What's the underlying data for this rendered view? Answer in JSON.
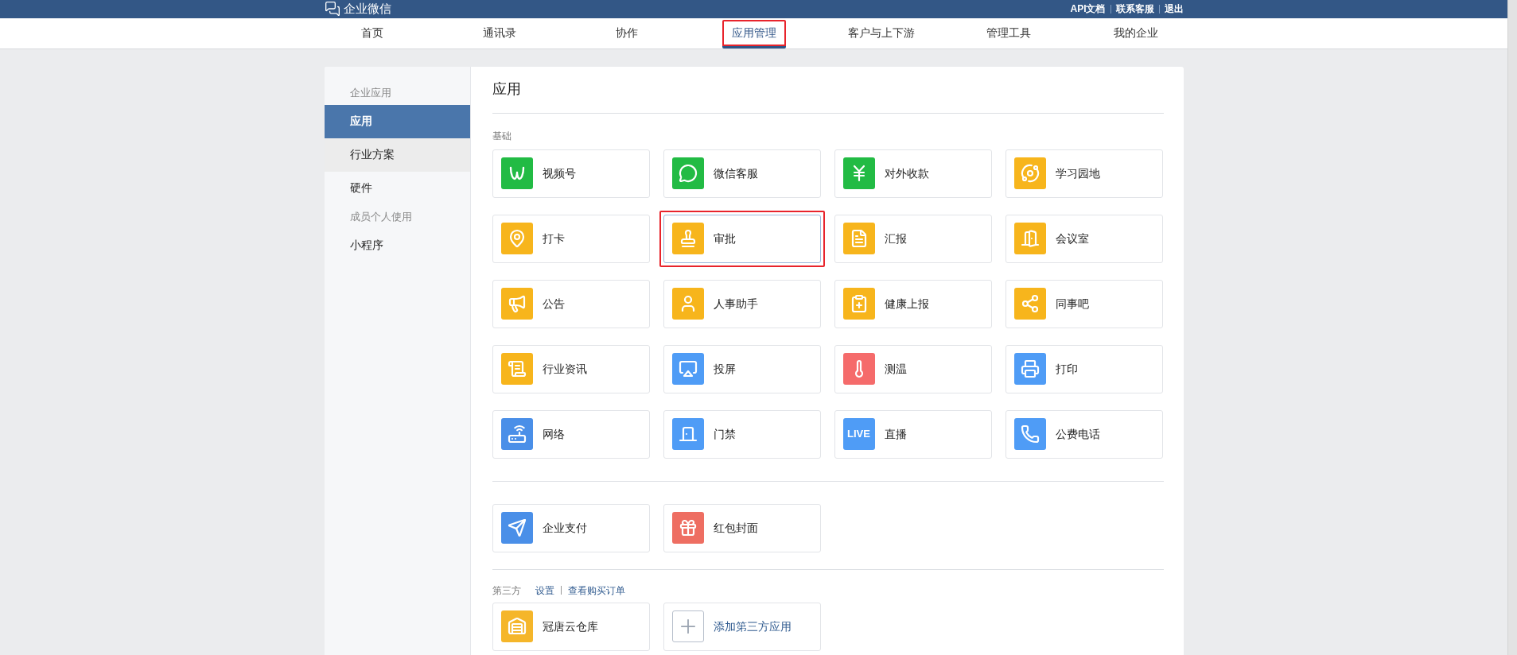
{
  "top_bar": {
    "logo_text": "企业微信",
    "links": [
      "API文档",
      "联系客服",
      "退出"
    ]
  },
  "nav": [
    {
      "label": "首页",
      "selected": false,
      "highlighted": false
    },
    {
      "label": "通讯录",
      "selected": false,
      "highlighted": false
    },
    {
      "label": "协作",
      "selected": false,
      "highlighted": false
    },
    {
      "label": "应用管理",
      "selected": true,
      "highlighted": true
    },
    {
      "label": "客户与上下游",
      "selected": false,
      "highlighted": false
    },
    {
      "label": "管理工具",
      "selected": false,
      "highlighted": false
    },
    {
      "label": "我的企业",
      "selected": false,
      "highlighted": false
    }
  ],
  "sidebar": [
    {
      "kind": "heading",
      "label": "企业应用"
    },
    {
      "kind": "item",
      "label": "应用",
      "selected": true,
      "hovered": false
    },
    {
      "kind": "item",
      "label": "行业方案",
      "selected": false,
      "hovered": true
    },
    {
      "kind": "item",
      "label": "硬件",
      "selected": false,
      "hovered": false
    },
    {
      "kind": "heading",
      "label": "成员个人使用"
    },
    {
      "kind": "item",
      "label": "小程序",
      "selected": false,
      "hovered": false
    }
  ],
  "page_title": "应用",
  "basic_section": {
    "label": "基础",
    "apps": [
      {
        "name": "视频号",
        "color": "#22bb44",
        "highlighted": false
      },
      {
        "name": "微信客服",
        "color": "#22bb44",
        "highlighted": false
      },
      {
        "name": "对外收款",
        "color": "#22bb44",
        "highlighted": false
      },
      {
        "name": "学习园地",
        "color": "#f7b51c",
        "highlighted": false
      },
      {
        "name": "打卡",
        "color": "#f7b51c",
        "highlighted": false
      },
      {
        "name": "审批",
        "color": "#f7b51c",
        "highlighted": true
      },
      {
        "name": "汇报",
        "color": "#f7b51c",
        "highlighted": false
      },
      {
        "name": "会议室",
        "color": "#f7b51c",
        "highlighted": false
      },
      {
        "name": "公告",
        "color": "#f7b51c",
        "highlighted": false
      },
      {
        "name": "人事助手",
        "color": "#f7b51c",
        "highlighted": false
      },
      {
        "name": "健康上报",
        "color": "#f7b51c",
        "highlighted": false
      },
      {
        "name": "同事吧",
        "color": "#f7b51c",
        "highlighted": false
      },
      {
        "name": "行业资讯",
        "color": "#f7b51c",
        "highlighted": false
      },
      {
        "name": "投屏",
        "color": "#4f9cf6",
        "highlighted": false
      },
      {
        "name": "测温",
        "color": "#f56b6b",
        "highlighted": false
      },
      {
        "name": "打印",
        "color": "#4f9cf6",
        "highlighted": false
      },
      {
        "name": "网络",
        "color": "#4a8fe8",
        "highlighted": false
      },
      {
        "name": "门禁",
        "color": "#4f9cf6",
        "highlighted": false
      },
      {
        "name": "直播",
        "color": "#4f9cf6",
        "highlighted": false,
        "icon_text": "LIVE"
      },
      {
        "name": "公费电话",
        "color": "#4f9cf6",
        "highlighted": false
      }
    ]
  },
  "extra_section": {
    "apps": [
      {
        "name": "企业支付",
        "color": "#4a8fe8",
        "highlighted": false
      },
      {
        "name": "红包封面",
        "color": "#ee6e62",
        "highlighted": false
      }
    ]
  },
  "third_party_section": {
    "label": "第三方",
    "links": [
      "设置",
      "查看购买订单"
    ],
    "apps": [
      {
        "kind": "app",
        "name": "冠唐云仓库",
        "color": "#f5b62a",
        "highlighted": false
      },
      {
        "kind": "add",
        "name": "添加第三方应用",
        "highlighted": false
      }
    ]
  }
}
